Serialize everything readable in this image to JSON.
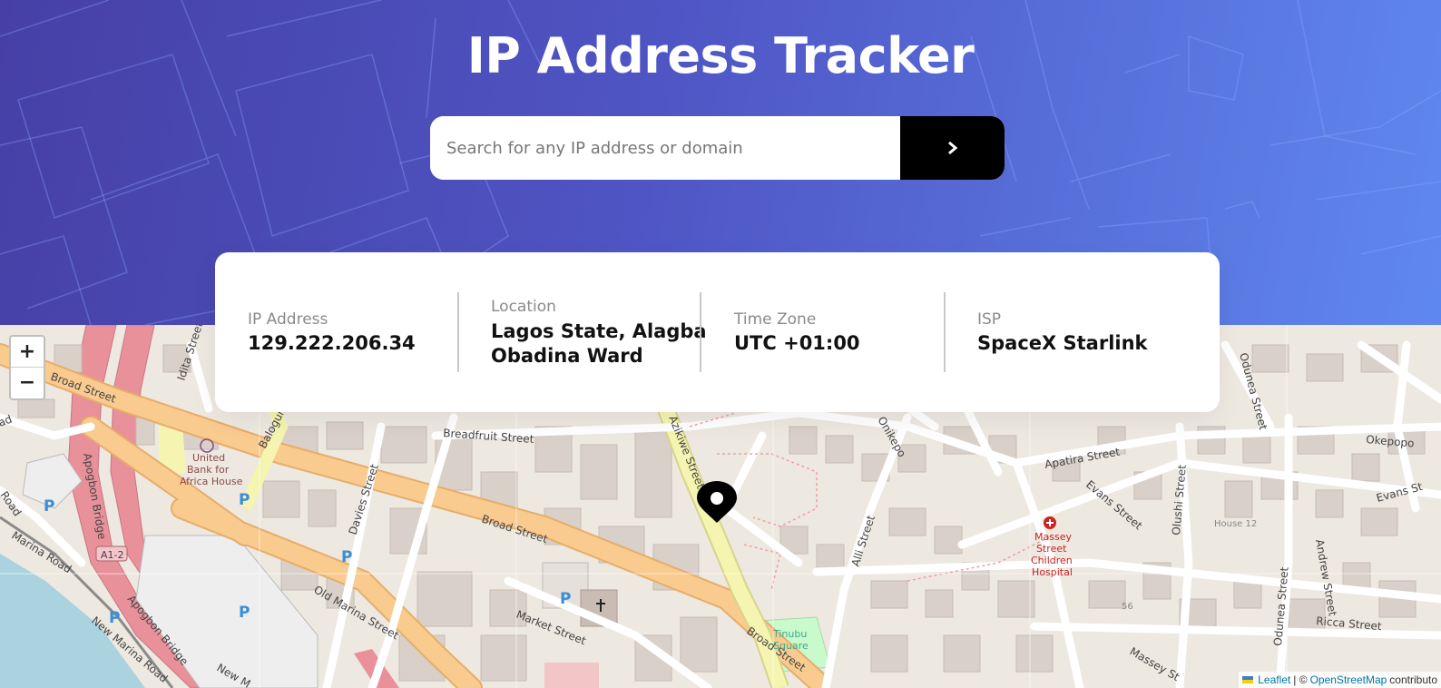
{
  "header": {
    "title": "IP Address Tracker"
  },
  "search": {
    "placeholder": "Search for any IP address or domain",
    "value": "",
    "button_icon": "chevron-right-icon"
  },
  "info": {
    "ip": {
      "label": "IP Address",
      "value": "129.222.206.34"
    },
    "location": {
      "label": "Location",
      "value_line1": "Lagos State, Alagba",
      "value_line2": "Obadina Ward"
    },
    "timezone": {
      "label": "Time Zone",
      "value": "UTC +01:00"
    },
    "isp": {
      "label": "ISP",
      "value": "SpaceX Starlink"
    }
  },
  "map": {
    "zoom_in": "+",
    "zoom_out": "−",
    "attribution": {
      "leaflet": "Leaflet",
      "separator": "| ©",
      "osm": "OpenStreetMap",
      "suffix": "contributo"
    },
    "street_labels": {
      "broad_street_left": "Broad Street",
      "idita": "Idita Street",
      "balogun": "Balogun",
      "breadfruit": "Breadfruit Street",
      "azikiwe": "Azikiwe Street",
      "davies": "Davies Street",
      "broad_street_mid": "Broad Street",
      "broad_street_low": "Broad Street",
      "old_marina": "Old Marina Street",
      "market": "Market Street",
      "apogbon_bridge_1": "Apogbon Bridge",
      "apogbon_bridge_2": "Apogbon Bridge",
      "marina_road": "Marina Road",
      "new_marina": "New Marina Road",
      "new_m": "New M",
      "road": "Road",
      "ad": "ad",
      "a12": "A1-2",
      "onikepo": "Onikepo",
      "apatira": "Apatira Street",
      "evans1": "Evans Street",
      "evans2": "Evans St",
      "olushi": "Olushi Street",
      "odunea1": "Odunea Street",
      "odunea2": "Odunea Street",
      "okepopo": "Okepopo",
      "alli": "Alli Street",
      "andrew": "Andrew Street",
      "ricca": "Ricca Street",
      "massey_st": "Massey St",
      "house12": "House 12",
      "num56": "56",
      "hospital1": "Massey",
      "hospital2": "Street",
      "hospital3": "Children",
      "hospital4": "Hospital",
      "bank1": "United",
      "bank2": "Bank for",
      "bank3": "Africa House",
      "tinubu1": "Tinubu",
      "tinubu2": "Square",
      "parking": "P"
    }
  },
  "colors": {
    "header_start": "#4640a6",
    "header_end": "#5f88ee",
    "button": "#000000",
    "road_main": "#f9cb8f",
    "road_primary": "#e8919a",
    "road_secondary": "#f5f4b0",
    "water": "#aad3df",
    "building": "#d9d0c9",
    "land": "#ede8e0"
  }
}
